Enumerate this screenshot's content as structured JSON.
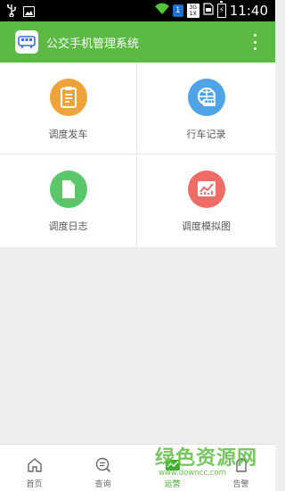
{
  "status_bar": {
    "time": "11:40",
    "sim_label": "1",
    "network_top": "3G",
    "network_bottom": "1X",
    "battery_symbol": "⚡",
    "icons": [
      "usb-icon",
      "image-icon",
      "wifi-icon",
      "sim-icon",
      "network-3g-icon",
      "sd-card-icon",
      "battery-icon"
    ]
  },
  "app_bar": {
    "title": "公交手机管理系统",
    "icon": "bus-icon",
    "menu_icon": "more-vertical-icon"
  },
  "grid": {
    "tiles": [
      {
        "label": "调度发车",
        "icon": "dispatch-clipboard-icon",
        "color": "#f0a23b"
      },
      {
        "label": "行车记录",
        "icon": "bus-globe-icon",
        "color": "#4ea4e6"
      },
      {
        "label": "调度日志",
        "icon": "log-document-icon",
        "color": "#5cc66a"
      },
      {
        "label": "调度模拟图",
        "icon": "simulation-chart-icon",
        "color": "#ee6b66"
      }
    ]
  },
  "bottom_nav": {
    "items": [
      {
        "label": "首页",
        "icon": "home-icon"
      },
      {
        "label": "查询",
        "icon": "search-icon"
      },
      {
        "label": "运营",
        "icon": "operation-icon",
        "active": true
      },
      {
        "label": "告警",
        "icon": "alert-icon"
      }
    ]
  },
  "watermark": {
    "text_cn": "绿色资源网",
    "text_en": "www.downcc.com"
  },
  "colors": {
    "primary": "#5bb944",
    "background": "#efefef",
    "active_nav": "#3fae2e"
  }
}
